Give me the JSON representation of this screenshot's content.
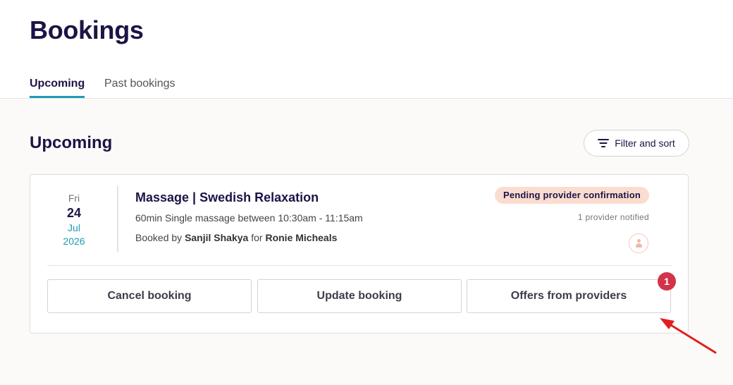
{
  "page": {
    "title": "Bookings"
  },
  "tabs": [
    {
      "label": "Upcoming",
      "active": true
    },
    {
      "label": "Past bookings",
      "active": false
    }
  ],
  "section": {
    "title": "Upcoming",
    "filter_label": "Filter and sort",
    "filter_icon": "filter-icon"
  },
  "booking": {
    "date": {
      "dow": "Fri",
      "day": "24",
      "month": "Jul",
      "year": "2026"
    },
    "service_title": "Massage | Swedish Relaxation",
    "detail": "60min Single massage between 10:30am - 11:15am",
    "booked_by_prefix": "Booked by",
    "booked_by": "Sanjil Shakya",
    "for_prefix": "for",
    "for_name": "Ronie Micheals",
    "status": "Pending provider confirmation",
    "notified": "1 provider notified",
    "avatar_icon": "user-icon",
    "actions": {
      "cancel": "Cancel booking",
      "update": "Update booking",
      "offers": "Offers from providers",
      "offers_count": "1"
    }
  },
  "colors": {
    "primary": "#1c1446",
    "accent": "#1a9db4",
    "badge_bg": "#fbddd0",
    "notification": "#d2334b",
    "annotation_arrow": "#e02020"
  }
}
